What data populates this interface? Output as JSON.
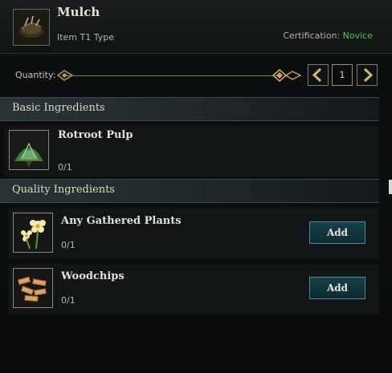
{
  "item": {
    "title": "Mulch",
    "type": "Item T1 Type",
    "certification_label": "Certification:",
    "certification_level": "Novice"
  },
  "quantity": {
    "label": "Quantity:",
    "value": "1",
    "slider_fraction": 1.0
  },
  "sections": {
    "basic": "Basic Ingredients",
    "quality": "Quality Ingredients"
  },
  "basic_ingredients": [
    {
      "name": "Rotroot Pulp",
      "count": "0/1",
      "icon": "herb-bundle-icon"
    }
  ],
  "quality_ingredients": [
    {
      "name": "Any Gathered Plants",
      "count": "0/1",
      "icon": "flower-icon",
      "button": "Add"
    },
    {
      "name": "Woodchips",
      "count": "0/1",
      "icon": "woodchips-icon",
      "button": "Add"
    }
  ],
  "colors": {
    "certification_level": "#3ed13e",
    "add_button_border": "#4e8d95",
    "slider_gold": "#b59a55"
  }
}
